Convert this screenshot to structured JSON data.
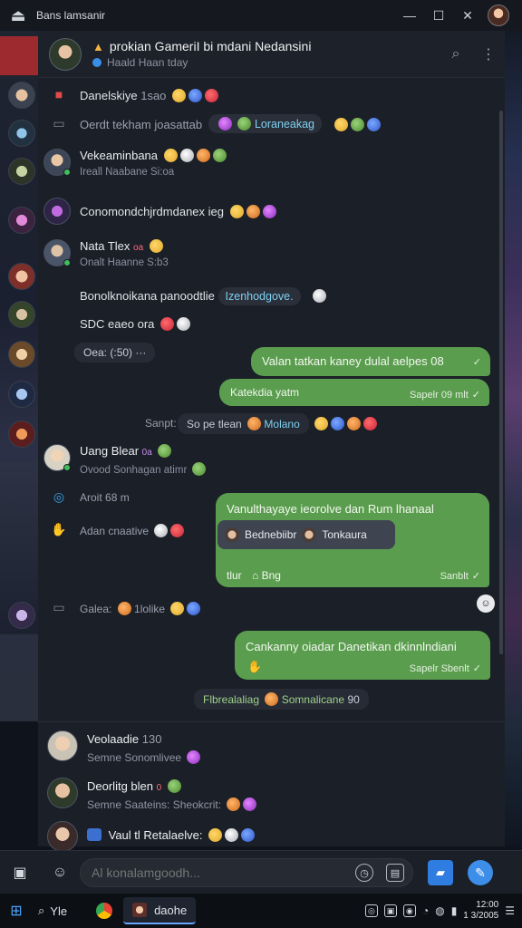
{
  "window": {
    "title": "Bans lamsanir",
    "logo_icon": "⏏",
    "min_icon": "—",
    "max_icon": "☐",
    "close_icon": "✕"
  },
  "header": {
    "name": "prokian GameriI bi mdani Nedansini",
    "status": "Haald Haan tday",
    "search_icon": "⌕",
    "menu_icon": "⋮"
  },
  "messages": {
    "m1": {
      "name": "Danelskiye",
      "time": "1sao"
    },
    "m2": {
      "text": "Oerdt tekham joasattab",
      "chip": "Loraneakag"
    },
    "m3": {
      "name": "Vekeaminbana",
      "sub": "Ireall Naabane Si:oa"
    },
    "m4": {
      "text": "Conomondchjrdmdanex ieg"
    },
    "m5": {
      "name": "Nata Tlex",
      "badge": "oa",
      "sub": "Onalt Haanne S:b3"
    },
    "m6": {
      "text": "Bonolknoikana panoodtlie",
      "link": "Izenhodgove."
    },
    "m7": {
      "text": "SDC eaeo ora"
    },
    "m8": {
      "text": "Oea:",
      "time": "(:50)"
    },
    "out1": {
      "text": "Valan tatkan kaney dulal aelpes 08"
    },
    "out2": {
      "text": "Katekdia yatm",
      "meta": "Sapelr 09 mlt"
    },
    "m9": {
      "prefix": "Sanpt:",
      "text": "So pe tlean",
      "link": "Molano"
    },
    "m10": {
      "name": "Uang Blear",
      "badge": "0a",
      "sub": "Ovood Sonhagan atimr"
    },
    "m11": {
      "text": "Aroit",
      "time": "68 m"
    },
    "m12": {
      "text": "Adan cnaative"
    },
    "out3": {
      "text": "Vanulthayaye ieorolve dan Rum lhanaal",
      "card_name": "Bednebiibr",
      "card_sub": "Tonkaura",
      "footer": "tlur",
      "footer2": "Bng",
      "meta": "Sanblt"
    },
    "m13": {
      "text": "Galea:",
      "extra": "1lolike"
    },
    "out4": {
      "text": "Cankanny oiadar Danetikan dkinnlndiani",
      "meta": "Sapelr Sbenlt"
    },
    "m14": {
      "text": "Flbrealaliag",
      "link": "Somnalicane",
      "time": "90"
    }
  },
  "contacts": [
    {
      "name": "Veolaadie",
      "time": "130",
      "sub": "Semne Sonomlivee"
    },
    {
      "name": "Deorlitg blen",
      "badge": "0",
      "sub": "Semne Saateins: Sheokcrit:"
    },
    {
      "name": "Vaul tl Retalaelve:",
      "sub": ""
    }
  ],
  "composer": {
    "placeholder": "Al konalamgoodh..."
  },
  "taskbar": {
    "search_label": "Yle",
    "active_app": "daohe",
    "time": "12:00",
    "date": "1 3/2005"
  }
}
